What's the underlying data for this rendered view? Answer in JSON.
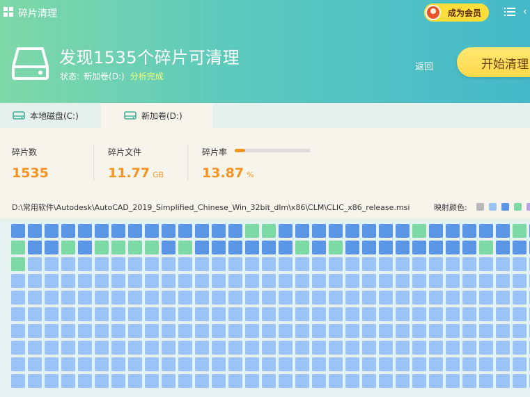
{
  "app": {
    "title": "碎片清理",
    "vip_label": "成为会员"
  },
  "header": {
    "headline": "发现1535个碎片可清理",
    "status_label": "状态:",
    "status_volume": "新加卷(D:)",
    "status_state": "分析完成",
    "return_label": "返回",
    "start_label": "开始清理"
  },
  "tabs": [
    {
      "label": "本地磁盘(C:)",
      "active": false
    },
    {
      "label": "新加卷(D:)",
      "active": true
    }
  ],
  "stats": {
    "fragments": {
      "label": "碎片数",
      "value": "1535"
    },
    "files": {
      "label": "碎片文件",
      "value": "11.77",
      "unit": "GB"
    },
    "rate": {
      "label": "碎片率",
      "value": "13.87",
      "unit": "%",
      "fraction": 0.1387
    }
  },
  "file_path": "D:\\常用软件\\Autodesk\\AutoCAD_2019_Simplified_Chinese_Win_32bit_dlm\\x86\\CLM\\CLIC_x86_release.msi",
  "legend": {
    "label": "映射颜色:",
    "colors": [
      "#b9b9b9",
      "#9cc3f5",
      "#5b96e6",
      "#7dd9a6",
      "#b9a3ee"
    ]
  },
  "block_map": {
    "colors": {
      "D": "#5b96e6",
      "L": "#9cc3f5",
      "G": "#7dd9a6"
    },
    "rows": [
      "DDDDDDDDDDDDDDGGDDDDDDDDGDDDDDGD",
      "GDDGDGGGGDGDDDDDDGDGDDDDDDDDGDDD",
      "GLLLLLLLLLLLLLLLLLLLLLLLLLLLLLLL",
      "LLLLLLLLLLLLLLLLLLLLLLLLLLLLLLLL",
      "LLLLLLLLLLLLLLLLLLLLLLLLLLLLLLLL",
      "LLLLLLLLLLLLLLLLLLLLLLLLLLLLLLLL",
      "LLLLLLLLLLLLLLLLLLLLLLLLLLLLLLLL",
      "LLLLLLLLLLLLLLLLLLLLLLLLLLLLLLLL",
      "LLLLLLLLLLLLLLLLLLLLLLLLLLLLLLLL",
      "LLLLLLLLLLLLLLLLLLLLLLLLLLLLLLLL"
    ]
  }
}
